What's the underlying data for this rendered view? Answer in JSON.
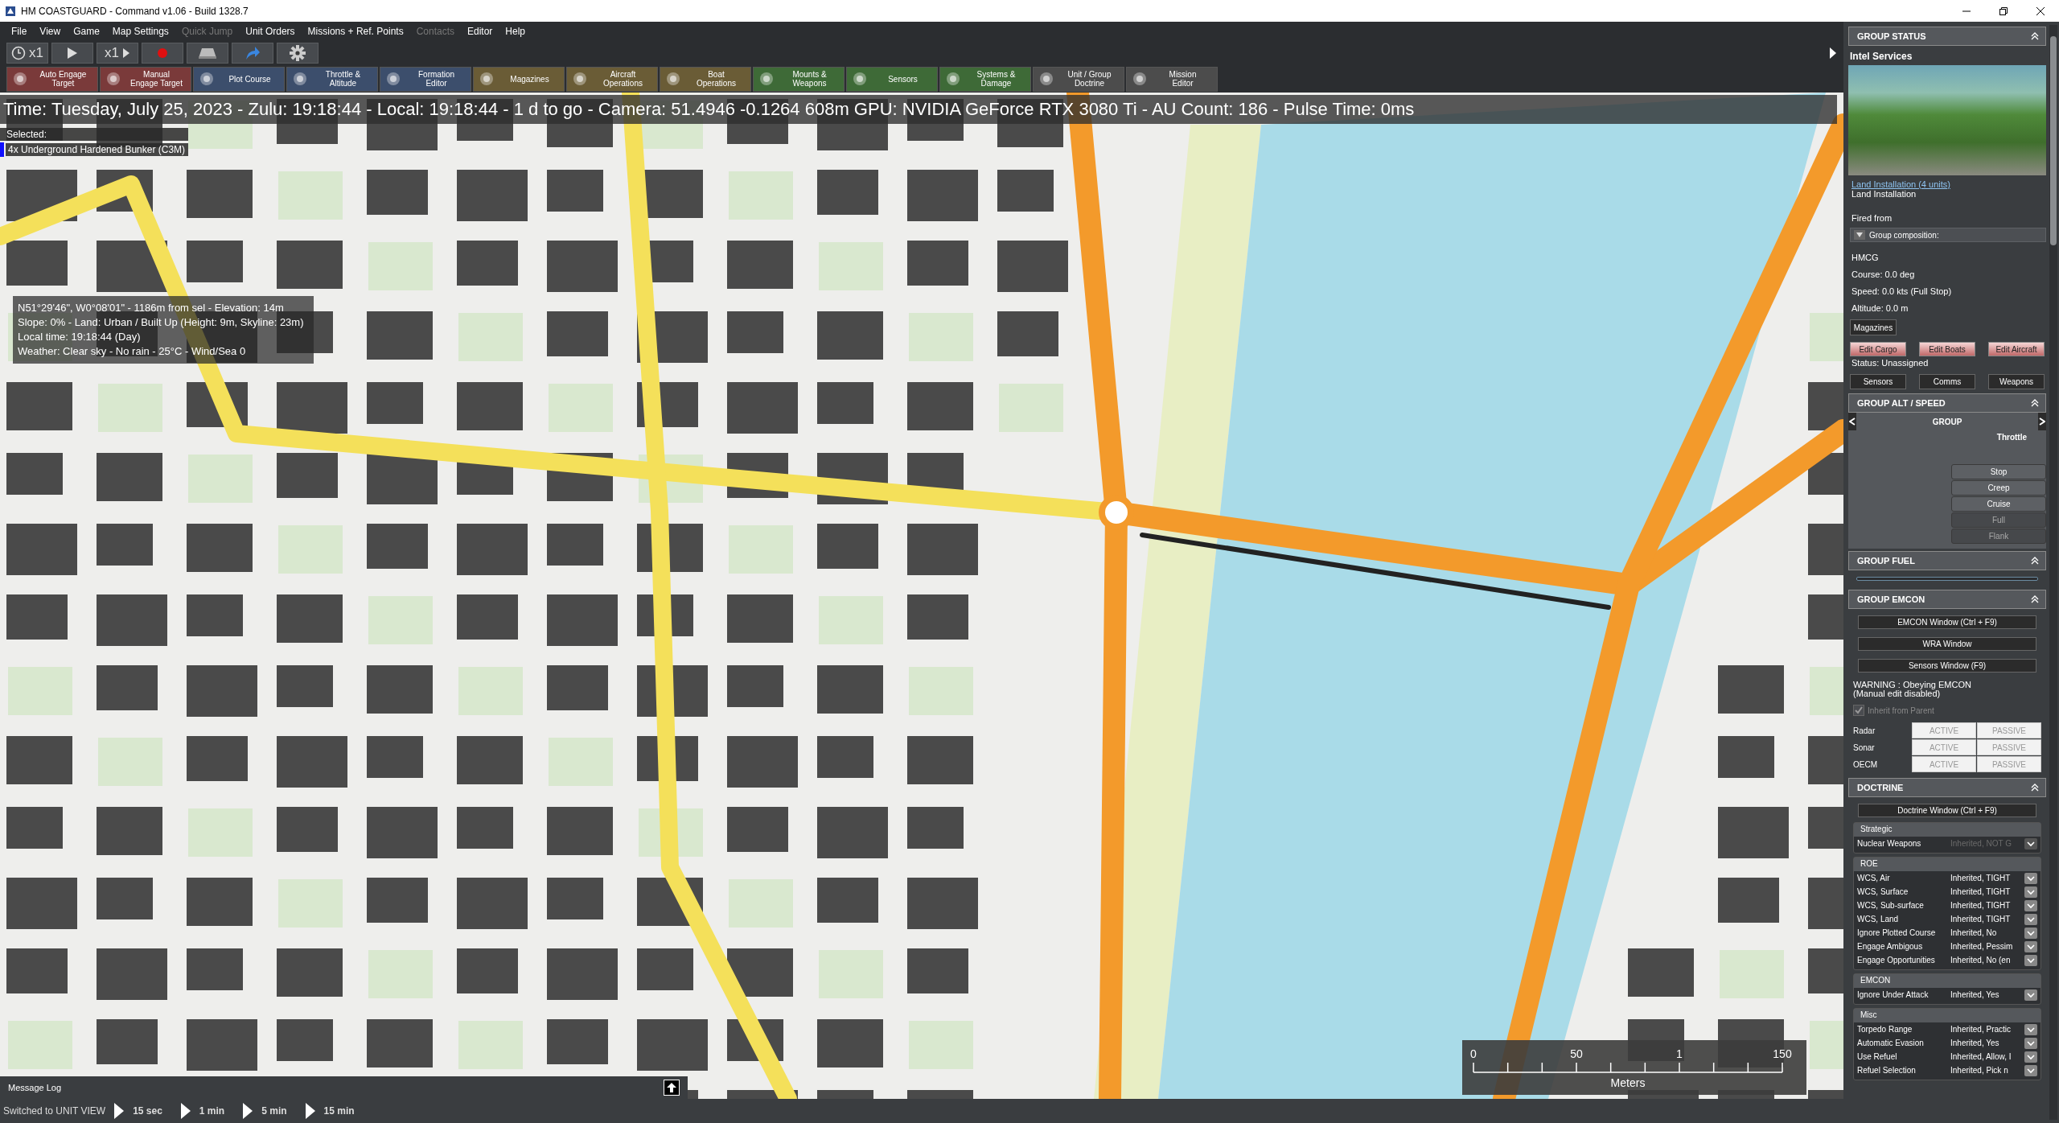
{
  "window": {
    "title": "HM COASTGUARD - Command v1.06 - Build 1328.7"
  },
  "menu": [
    {
      "label": "File",
      "disabled": false
    },
    {
      "label": "View",
      "disabled": false
    },
    {
      "label": "Game",
      "disabled": false
    },
    {
      "label": "Map Settings",
      "disabled": false
    },
    {
      "label": "Quick Jump",
      "disabled": true
    },
    {
      "label": "Unit Orders",
      "disabled": false
    },
    {
      "label": "Missions + Ref. Points",
      "disabled": false
    },
    {
      "label": "Contacts",
      "disabled": true
    },
    {
      "label": "Editor",
      "disabled": false
    },
    {
      "label": "Help",
      "disabled": false
    }
  ],
  "toolbar": [
    {
      "kind": "clock",
      "label": "x1"
    },
    {
      "kind": "play"
    },
    {
      "kind": "speed",
      "label": "x1"
    },
    {
      "kind": "record"
    },
    {
      "kind": "terrain"
    },
    {
      "kind": "arrow"
    },
    {
      "kind": "gear"
    }
  ],
  "action_bar": [
    {
      "label": "Auto Engage\nTarget",
      "color": "#7a3a3a"
    },
    {
      "label": "Manual\nEngage Target",
      "color": "#7a3a3a"
    },
    {
      "label": "Plot Course",
      "color": "#3c4e6c"
    },
    {
      "label": "Throttle &\nAltitude",
      "color": "#3c4e6c"
    },
    {
      "label": "Formation\nEditor",
      "color": "#3c4e6c"
    },
    {
      "label": "Magazines",
      "color": "#6a5c36"
    },
    {
      "label": "Aircraft\nOperations",
      "color": "#6a5c36"
    },
    {
      "label": "Boat\nOperations",
      "color": "#6a5c36"
    },
    {
      "label": "Mounts &\nWeapons",
      "color": "#3e6a37"
    },
    {
      "label": "Sensors",
      "color": "#3e6a37"
    },
    {
      "label": "Systems &\nDamage",
      "color": "#3e6a37"
    },
    {
      "label": "Unit / Group\nDoctrine",
      "color": "#4c4c4c"
    },
    {
      "label": "Mission\nEditor",
      "color": "#4c4c4c"
    }
  ],
  "map": {
    "status_line": "Time: Tuesday, July 25, 2023 - Zulu: 19:18:44 - Local: 19:18:44 - 1 d to go -  Camera: 51.4946 -0.1264 608m  GPU: NVIDIA GeForce RTX 3080 Ti - AU Count: 186 - Pulse Time: 0ms",
    "selected_label": "Selected:",
    "selected_unit": "4x Underground Hardened Bunker (C3M)",
    "cursor_info": [
      "N51°29'46\", W0°08'01\"  - 1186m from sel - Elevation: 14m",
      "Slope: 0%  - Land: Urban / Built Up (Height: 9m, Skyline: 23m)",
      "Local time: 19:18:44 (Day)",
      "Weather: Clear sky - No rain - 25°C - Wind/Sea 0"
    ],
    "scale": {
      "ticks": [
        "0",
        "50",
        "1",
        "150"
      ],
      "unit": "Meters"
    }
  },
  "message_log": {
    "title": "Message Log"
  },
  "status_bar": {
    "message": "Switched to UNIT VIEW",
    "steps": [
      "15 sec",
      "1 min",
      "5 min",
      "15 min"
    ]
  },
  "side_panel": {
    "group_status": {
      "title": "GROUP STATUS",
      "unit_name": "Intel Services",
      "link": "Land Installation (4 units)",
      "type": "Land Installation",
      "fired_from": "Fired from",
      "composition": {
        "label": "Group composition:",
        "expanded": false
      },
      "lines": [
        "HMCG",
        "Course: 0.0 deg",
        "Speed: 0.0 kts (Full Stop)",
        "Altitude: 0.0 m"
      ],
      "magazines_button": "Magazines",
      "edit_buttons": [
        "Edit Cargo",
        "Edit Boats",
        "Edit Aircraft"
      ],
      "status": "Status: Unassigned",
      "tabs": [
        "Sensors",
        "Comms",
        "Weapons"
      ]
    },
    "alt_speed": {
      "title": "GROUP ALT / SPEED",
      "group_label": "GROUP",
      "throttle_label": "Throttle",
      "throttle": [
        {
          "label": "Stop",
          "disabled": false
        },
        {
          "label": "Creep",
          "disabled": false
        },
        {
          "label": "Cruise",
          "disabled": false
        },
        {
          "label": "Full",
          "disabled": true
        },
        {
          "label": "Flank",
          "disabled": true
        }
      ]
    },
    "fuel": {
      "title": "GROUP FUEL"
    },
    "emcon": {
      "title": "GROUP EMCON",
      "buttons": [
        "EMCON Window (Ctrl + F9)",
        "WRA Window",
        "Sensors Window (F9)"
      ],
      "warning": [
        "WARNING : Obeying EMCON",
        "(Manual edit disabled)"
      ],
      "inherit": {
        "label": "Inherit from Parent",
        "checked": true,
        "disabled": true
      },
      "sensors": [
        {
          "name": "Radar",
          "modes": [
            "ACTIVE",
            "PASSIVE"
          ]
        },
        {
          "name": "Sonar",
          "modes": [
            "ACTIVE",
            "PASSIVE"
          ]
        },
        {
          "name": "OECM",
          "modes": [
            "ACTIVE",
            "PASSIVE"
          ]
        }
      ]
    },
    "doctrine": {
      "title": "DOCTRINE",
      "button": "Doctrine Window (Ctrl + F9)",
      "sections": [
        {
          "title": "Strategic",
          "rows": [
            {
              "name": "Nuclear Weapons",
              "value": "Inherited, NOT G",
              "disabled": true
            }
          ]
        },
        {
          "title": "ROE",
          "rows": [
            {
              "name": "WCS, Air",
              "value": "Inherited, TIGHT",
              "disabled": false
            },
            {
              "name": "WCS, Surface",
              "value": "Inherited, TIGHT",
              "disabled": false
            },
            {
              "name": "WCS, Sub-surface",
              "value": "Inherited, TIGHT",
              "disabled": false
            },
            {
              "name": "WCS, Land",
              "value": "Inherited, TIGHT",
              "disabled": false
            },
            {
              "name": "Ignore Plotted Course",
              "value": "Inherited, No",
              "disabled": false
            },
            {
              "name": "Engage Ambigous",
              "value": "Inherited, Pessim",
              "disabled": false
            },
            {
              "name": "Engage Opportunities",
              "value": "Inherited, No (en",
              "disabled": false
            }
          ]
        },
        {
          "title": "EMCON",
          "rows": [
            {
              "name": "Ignore Under Attack",
              "value": "Inherited, Yes",
              "disabled": false
            }
          ]
        },
        {
          "title": "Misc",
          "rows": [
            {
              "name": "Torpedo Range",
              "value": "Inherited, Practic",
              "disabled": false
            },
            {
              "name": "Automatic Evasion",
              "value": "Inherited, Yes",
              "disabled": false
            },
            {
              "name": "Use Refuel",
              "value": "Inherited, Allow, I",
              "disabled": false
            },
            {
              "name": "Refuel Selection",
              "value": "Inherited, Pick n",
              "disabled": false
            }
          ]
        }
      ]
    }
  }
}
